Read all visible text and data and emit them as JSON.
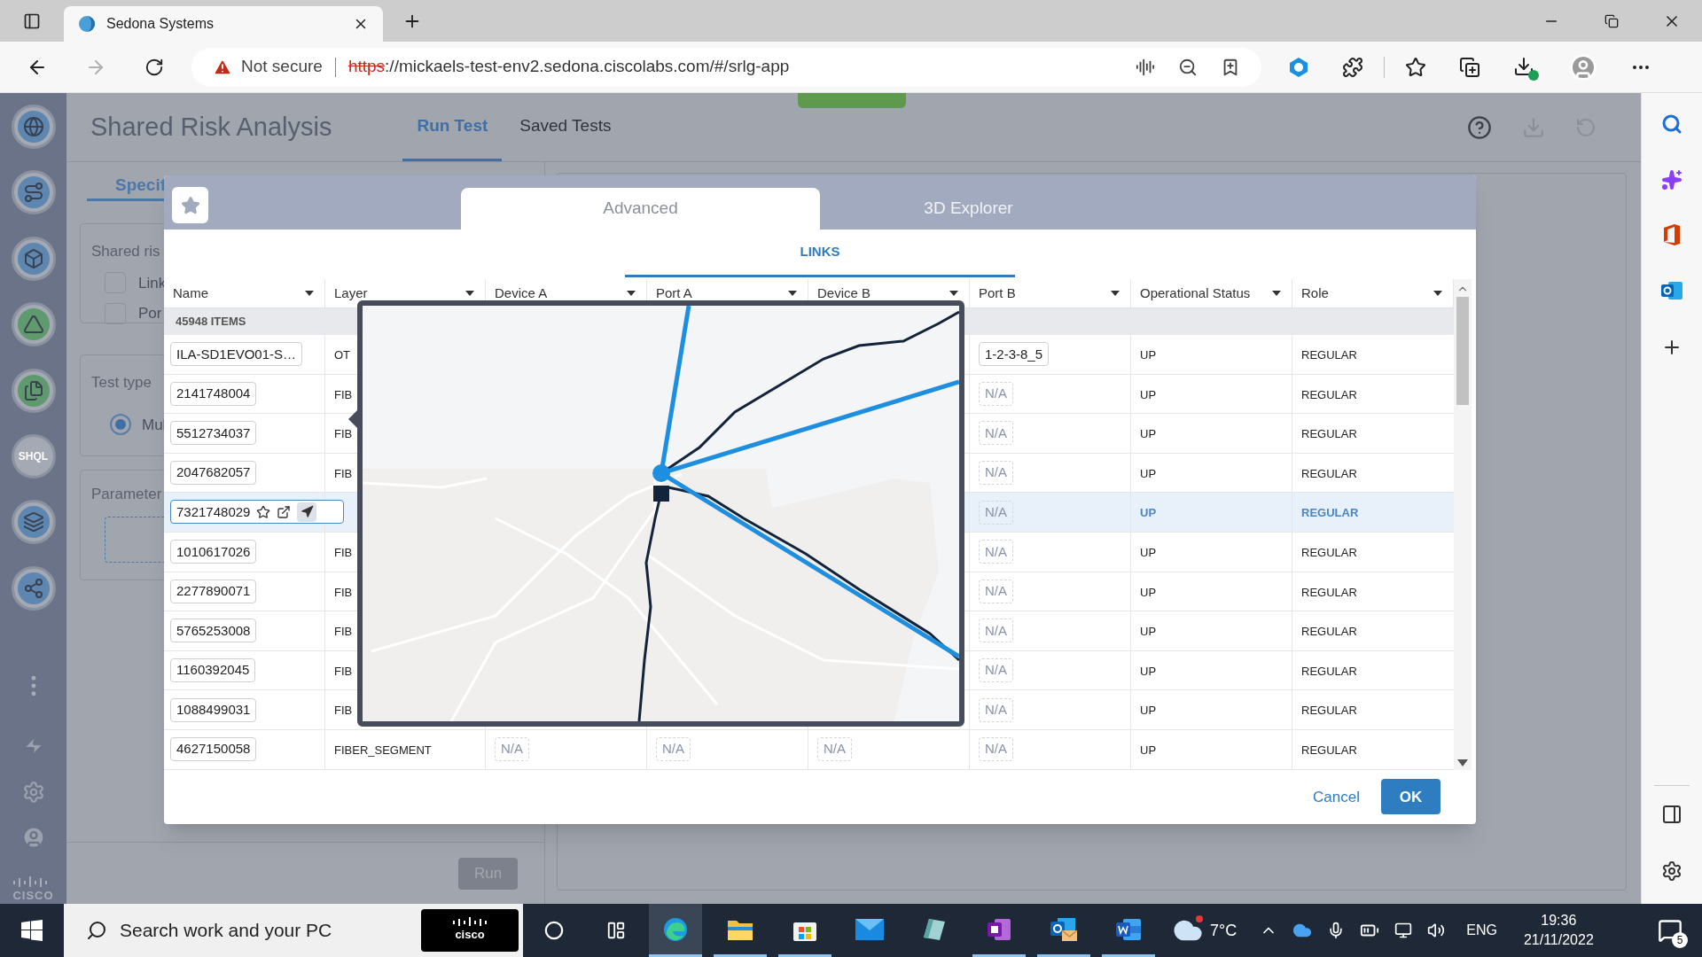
{
  "browser": {
    "tab_title": "Sedona Systems",
    "security_label": "Not secure",
    "url_scheme": "https",
    "url_rest": "://mickaels-test-env2.sedona.ciscolabs.com/#/srlg-app"
  },
  "app": {
    "nav_badge": "SHQL",
    "logo_text": "CISCO",
    "title": "Shared Risk Analysis",
    "tabs": [
      {
        "label": "Run Test",
        "selected": true
      },
      {
        "label": "Saved Tests",
        "selected": false
      }
    ],
    "left_panel": {
      "tab": "Specif",
      "shared_risk_label": "Shared ris",
      "checkboxes": [
        {
          "label": "Link",
          "checked": false
        },
        {
          "label": "Por",
          "checked": false
        }
      ],
      "test_type_label": "Test type",
      "radios": [
        {
          "label": "Mul",
          "selected": true
        }
      ],
      "parameters_label": "Parameter",
      "run_button": "Run"
    }
  },
  "dialog": {
    "tabs": [
      {
        "label": "Advanced",
        "selected": true
      },
      {
        "label": "3D Explorer",
        "selected": false
      }
    ],
    "section": "LINKS",
    "columns": [
      "Name",
      "Layer",
      "Device A",
      "Port A",
      "Device B",
      "Port B",
      "Operational Status",
      "Role"
    ],
    "item_count": "45948 ITEMS",
    "rows": [
      {
        "name": "ILA-SD1EVO01-S…",
        "layer": "OT",
        "port_b": {
          "text": "1-2-3-8_5",
          "kind": "value"
        },
        "status": "UP",
        "role": "REGULAR",
        "selected": false
      },
      {
        "name": "2141748004",
        "layer": "FIB",
        "port_b": {
          "text": "N/A",
          "kind": "empty"
        },
        "status": "UP",
        "role": "REGULAR",
        "selected": false
      },
      {
        "name": "5512734037",
        "layer": "FIB",
        "port_b": {
          "text": "N/A",
          "kind": "empty"
        },
        "status": "UP",
        "role": "REGULAR",
        "selected": false
      },
      {
        "name": "2047682057",
        "layer": "FIB",
        "port_b": {
          "text": "N/A",
          "kind": "empty"
        },
        "status": "UP",
        "role": "REGULAR",
        "selected": false
      },
      {
        "name": "7321748029",
        "port_b": {
          "text": "N/A",
          "kind": "empty"
        },
        "status": "UP",
        "role": "REGULAR",
        "selected": true
      },
      {
        "name": "1010617026",
        "layer": "FIB",
        "port_b": {
          "text": "N/A",
          "kind": "empty"
        },
        "status": "UP",
        "role": "REGULAR",
        "selected": false
      },
      {
        "name": "2277890071",
        "layer": "FIB",
        "port_b": {
          "text": "N/A",
          "kind": "empty"
        },
        "status": "UP",
        "role": "REGULAR",
        "selected": false
      },
      {
        "name": "5765253008",
        "layer": "FIB",
        "port_b": {
          "text": "N/A",
          "kind": "empty"
        },
        "status": "UP",
        "role": "REGULAR",
        "selected": false
      },
      {
        "name": "1160392045",
        "layer": "FIB",
        "port_b": {
          "text": "N/A",
          "kind": "empty"
        },
        "status": "UP",
        "role": "REGULAR",
        "selected": false
      },
      {
        "name": "1088499031",
        "layer": "FIB",
        "port_b": {
          "text": "N/A",
          "kind": "empty"
        },
        "status": "UP",
        "role": "REGULAR",
        "selected": false
      },
      {
        "name": "4627150058",
        "layer": "FIBER_SEGMENT",
        "device_a": {
          "text": "N/A",
          "kind": "empty"
        },
        "port_a": {
          "text": "N/A",
          "kind": "empty"
        },
        "device_b": {
          "text": "N/A",
          "kind": "empty"
        },
        "port_b": {
          "text": "N/A",
          "kind": "empty"
        },
        "status": "UP",
        "role": "REGULAR",
        "selected": false
      }
    ],
    "cancel": "Cancel",
    "ok": "OK"
  },
  "taskbar": {
    "search_placeholder": "Search work and your PC",
    "search_logo_text": "cisco",
    "apps": [
      {
        "kind": "edge",
        "running": true,
        "selected": true
      },
      {
        "kind": "explorer",
        "running": true,
        "selected": false
      },
      {
        "kind": "store",
        "running": true,
        "selected": false
      },
      {
        "kind": "mail",
        "running": false,
        "selected": false
      },
      {
        "kind": "notes",
        "running": false,
        "selected": false
      },
      {
        "kind": "onenote",
        "running": true,
        "selected": false
      },
      {
        "kind": "outlook",
        "running": true,
        "selected": false
      },
      {
        "kind": "word",
        "running": true,
        "selected": false
      }
    ],
    "temperature": "7°C",
    "language": "ENG",
    "time": "19:36",
    "date": "21/11/2022",
    "notifications": "5"
  }
}
